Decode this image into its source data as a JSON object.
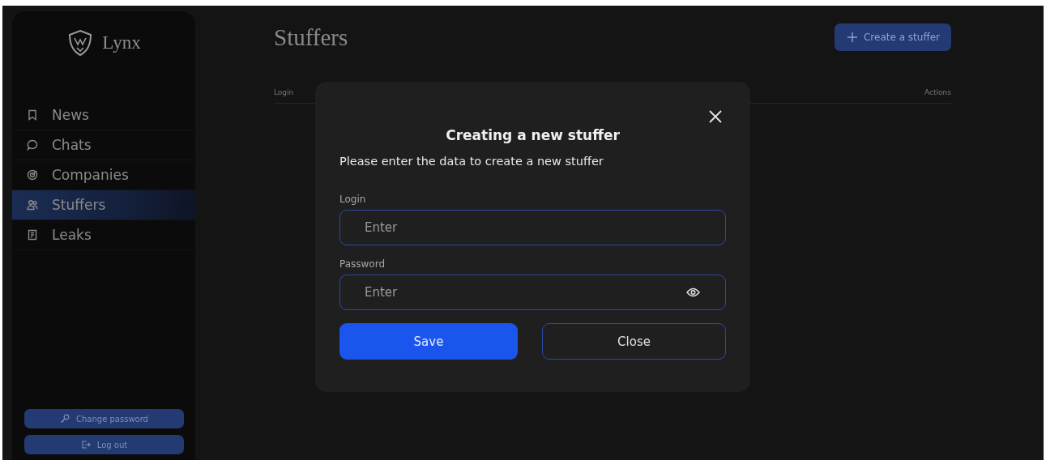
{
  "sidebar": {
    "brand": "Lynx",
    "nav": [
      {
        "label": "News",
        "selected": false
      },
      {
        "label": "Chats",
        "selected": false
      },
      {
        "label": "Companies",
        "selected": false
      },
      {
        "label": "Stuffers",
        "selected": true
      },
      {
        "label": "Leaks",
        "selected": false
      }
    ],
    "actions": [
      "Change password",
      "Log out"
    ]
  },
  "page": {
    "title": "Stuffers",
    "create_button": "Create a stuffer",
    "table": {
      "columns": [
        "Login",
        "Actions"
      ]
    }
  },
  "modal": {
    "title": "Creating a new stuffer",
    "subtitle": "Please enter the data to create a new stuffer",
    "fields": [
      {
        "label": "Login",
        "placeholder": "Enter",
        "kind": "text"
      },
      {
        "label": "Password",
        "placeholder": "Enter",
        "kind": "password"
      }
    ],
    "save_button": "Save",
    "close_button": "Close"
  }
}
